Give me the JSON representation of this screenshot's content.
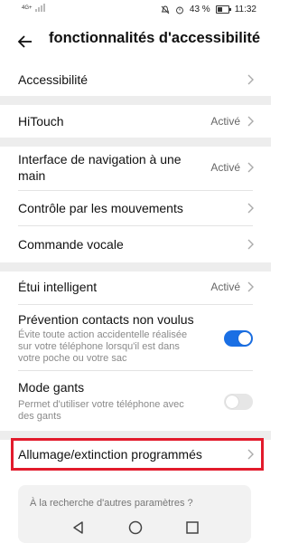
{
  "status_bar": {
    "signal_label": "4G+",
    "battery_percent": "43 %",
    "time": "11:32",
    "icons": [
      "signal-icon",
      "mute-icon",
      "alarm-icon",
      "battery-icon"
    ]
  },
  "header": {
    "title": "fonctionnalités d'accessibilité",
    "back_icon": "arrow-left-icon"
  },
  "items": {
    "accessibilite": {
      "label": "Accessibilité"
    },
    "hitouch": {
      "label": "HiTouch",
      "status": "Activé"
    },
    "nav_main_line1": "Interface de navigation à une",
    "nav_main_line2": "main",
    "nav_main_status": "Activé",
    "mouvements": {
      "label": "Contrôle par les mouvements"
    },
    "vocale": {
      "label": "Commande vocale"
    },
    "etui": {
      "label": "Étui intelligent",
      "status": "Activé"
    },
    "prevention": {
      "label": "Prévention contacts non voulus",
      "desc_line1": "Évite toute action accidentelle réalisée",
      "desc_line2": "sur votre téléphone lorsqu'il est dans",
      "desc_line3": "votre poche ou votre sac",
      "enabled": true
    },
    "gants": {
      "label": "Mode gants",
      "desc_line1": "Permet d'utiliser votre téléphone avec",
      "desc_line2": "des gants",
      "enabled": false
    },
    "allumage": {
      "label": "Allumage/extinction programmés"
    }
  },
  "search_card": {
    "text": "À la recherche d'autres paramètres ?"
  },
  "nav_bar": {
    "icons": [
      "back-triangle-icon",
      "home-circle-icon",
      "recents-square-icon"
    ]
  },
  "colors": {
    "accent": "#1a6fe4",
    "highlight": "#e21b2c",
    "separator": "#ededed"
  }
}
